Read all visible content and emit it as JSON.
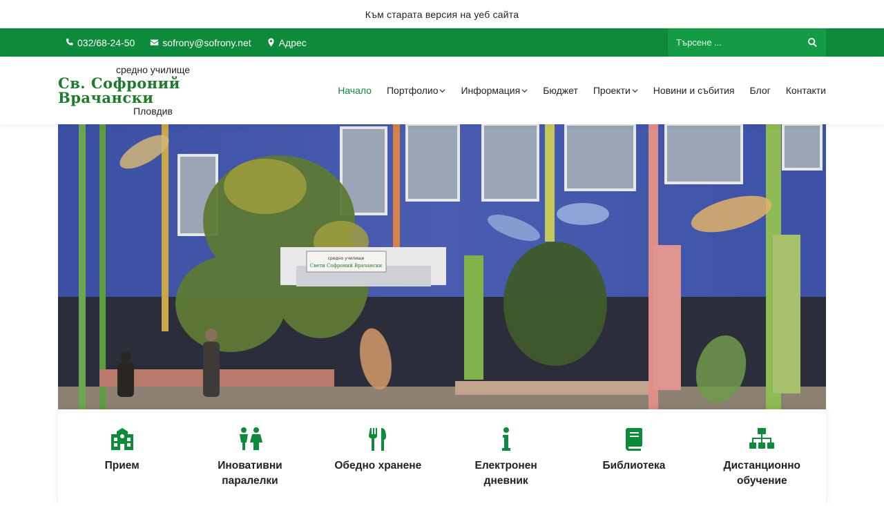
{
  "old_version_link": "Към старата версия на уеб сайта",
  "topbar": {
    "phone": "032/68-24-50",
    "email": "sofrony@sofrony.net",
    "address": "Адрес",
    "search_placeholder": "Търсене ..."
  },
  "logo": {
    "top": "средно училище",
    "main": "Св. Софроний Врачански",
    "bottom": "Пловдив"
  },
  "nav": [
    {
      "label": "Начало",
      "dropdown": false
    },
    {
      "label": "Портфолио",
      "dropdown": true
    },
    {
      "label": "Информация",
      "dropdown": true
    },
    {
      "label": "Бюджет",
      "dropdown": false
    },
    {
      "label": "Проекти",
      "dropdown": true
    },
    {
      "label": "Новини и събития",
      "dropdown": false
    },
    {
      "label": "Блог",
      "dropdown": false
    },
    {
      "label": "Контакти",
      "dropdown": false
    }
  ],
  "hero_sign": {
    "line1": "средно училище",
    "line2": "Свети Софроний Врачански"
  },
  "cards": [
    {
      "label": "Прием",
      "icon": "school-icon"
    },
    {
      "label": "Иновативни паралелки",
      "icon": "children-icon"
    },
    {
      "label": "Обедно хранене",
      "icon": "utensils-icon"
    },
    {
      "label": "Електронен дневник",
      "icon": "info-icon"
    },
    {
      "label": "Библиотека",
      "icon": "book-icon"
    },
    {
      "label": "Дистанционно обучение",
      "icon": "network-icon"
    }
  ],
  "colors": {
    "brand_green": "#0d8a3a",
    "search_green": "#149c45",
    "logo_green": "#1f7a2e"
  }
}
